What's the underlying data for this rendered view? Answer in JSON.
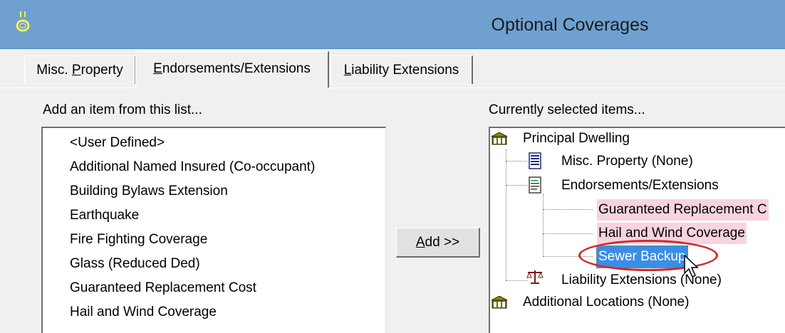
{
  "window": {
    "title": "Optional Coverages",
    "titlebar_color": "#6fa0cf",
    "icon": "ring-icon"
  },
  "tabs": [
    {
      "label_pre": "Misc. ",
      "label_ul": "P",
      "label_post": "roperty",
      "selected": false
    },
    {
      "label_pre": "",
      "label_ul": "E",
      "label_post": "ndorsements/Extensions",
      "selected": true
    },
    {
      "label_pre": "",
      "label_ul": "L",
      "label_post": "iability Extensions",
      "selected": false
    }
  ],
  "available": {
    "label": "Add an item from this list...",
    "items": [
      "<User Defined>",
      "Additional Named Insured (Co-occupant)",
      "Building Bylaws Extension",
      "Earthquake",
      "Fire Fighting Coverage",
      "Glass (Reduced Ded)",
      "Guaranteed Replacement Cost",
      "Hail and Wind Coverage"
    ]
  },
  "add_button": {
    "label_ul": "A",
    "label_post": "dd >>"
  },
  "selected": {
    "label": "Currently selected items...",
    "tree": {
      "principal": "Principal Dwelling",
      "misc": "Misc. Property (None)",
      "endorse": "Endorsements/Extensions",
      "endorse_items": [
        "Guaranteed Replacement C",
        "Hail and Wind Coverage",
        "Sewer Backup"
      ],
      "liability": "Liability Extensions (None)",
      "additional": "Additional Locations (None)"
    },
    "highlight_color": "#f7d3de",
    "selection_color": "#3a8ee6",
    "annotation_color": "#cc2b2b"
  }
}
